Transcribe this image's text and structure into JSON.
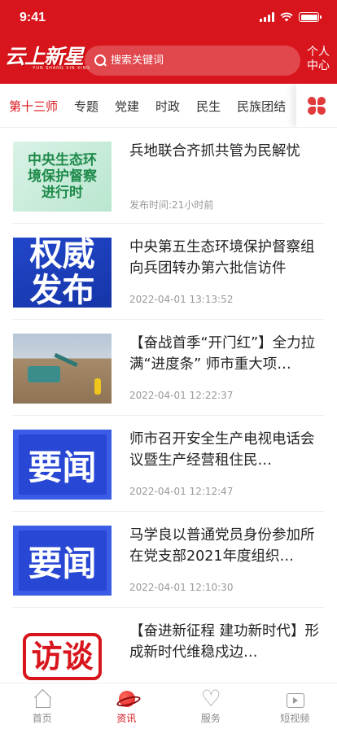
{
  "status_bar": {
    "time": "9:41"
  },
  "header": {
    "logo_text": "云上新星",
    "logo_subtext": "YUN SHANG XIN XING",
    "search_placeholder": "搜索关键词",
    "personal_center_line1": "个人",
    "personal_center_line2": "中心"
  },
  "tabs": {
    "items": [
      {
        "label": "第十三师",
        "active": true
      },
      {
        "label": "专题"
      },
      {
        "label": "党建"
      },
      {
        "label": "时政"
      },
      {
        "label": "民生"
      },
      {
        "label": "民族团结"
      }
    ],
    "more_icon": "grid-icon"
  },
  "feed": [
    {
      "title": "兵地联合齐抓共管为民解忧",
      "time": "发布时间:21小时前",
      "thumb_type": "green",
      "thumb_lines": [
        "中央生态环",
        "境保护督察",
        "进行时"
      ]
    },
    {
      "title": "中央第五生态环境保护督察组向兵团转办第六批信访件",
      "time": "2022-04-01 13:13:52",
      "thumb_type": "blue",
      "thumb_lines": [
        "权威",
        "发布"
      ]
    },
    {
      "title": "【奋战首季“开门红”】全力拉满“进度条” 师市重大项…",
      "time": "2022-04-01 12:22:37",
      "thumb_type": "photo",
      "thumb_lines": []
    },
    {
      "title": "师市召开安全生产电视电话会议暨生产经营租住民…",
      "time": "2022-04-01 12:12:47",
      "thumb_type": "blue2",
      "thumb_lines": [
        "要闻"
      ]
    },
    {
      "title": "马学良以普通党员身份参加所在党支部2021年度组织…",
      "time": "2022-04-01 12:10:30",
      "thumb_type": "blue2",
      "thumb_lines": [
        "要闻"
      ]
    },
    {
      "title": "【奋进新征程 建功新时代】形成新时代维稳戍边…",
      "time": "",
      "thumb_type": "red",
      "thumb_lines": [
        "访谈"
      ]
    }
  ],
  "bottom_nav": [
    {
      "label": "首页",
      "icon": "home-icon",
      "active": false
    },
    {
      "label": "资讯",
      "icon": "planet-icon",
      "active": true
    },
    {
      "label": "服务",
      "icon": "heart-icon",
      "active": false
    },
    {
      "label": "短视频",
      "icon": "tv-icon",
      "active": false
    }
  ],
  "colors": {
    "brand_red": "#d8151c"
  }
}
